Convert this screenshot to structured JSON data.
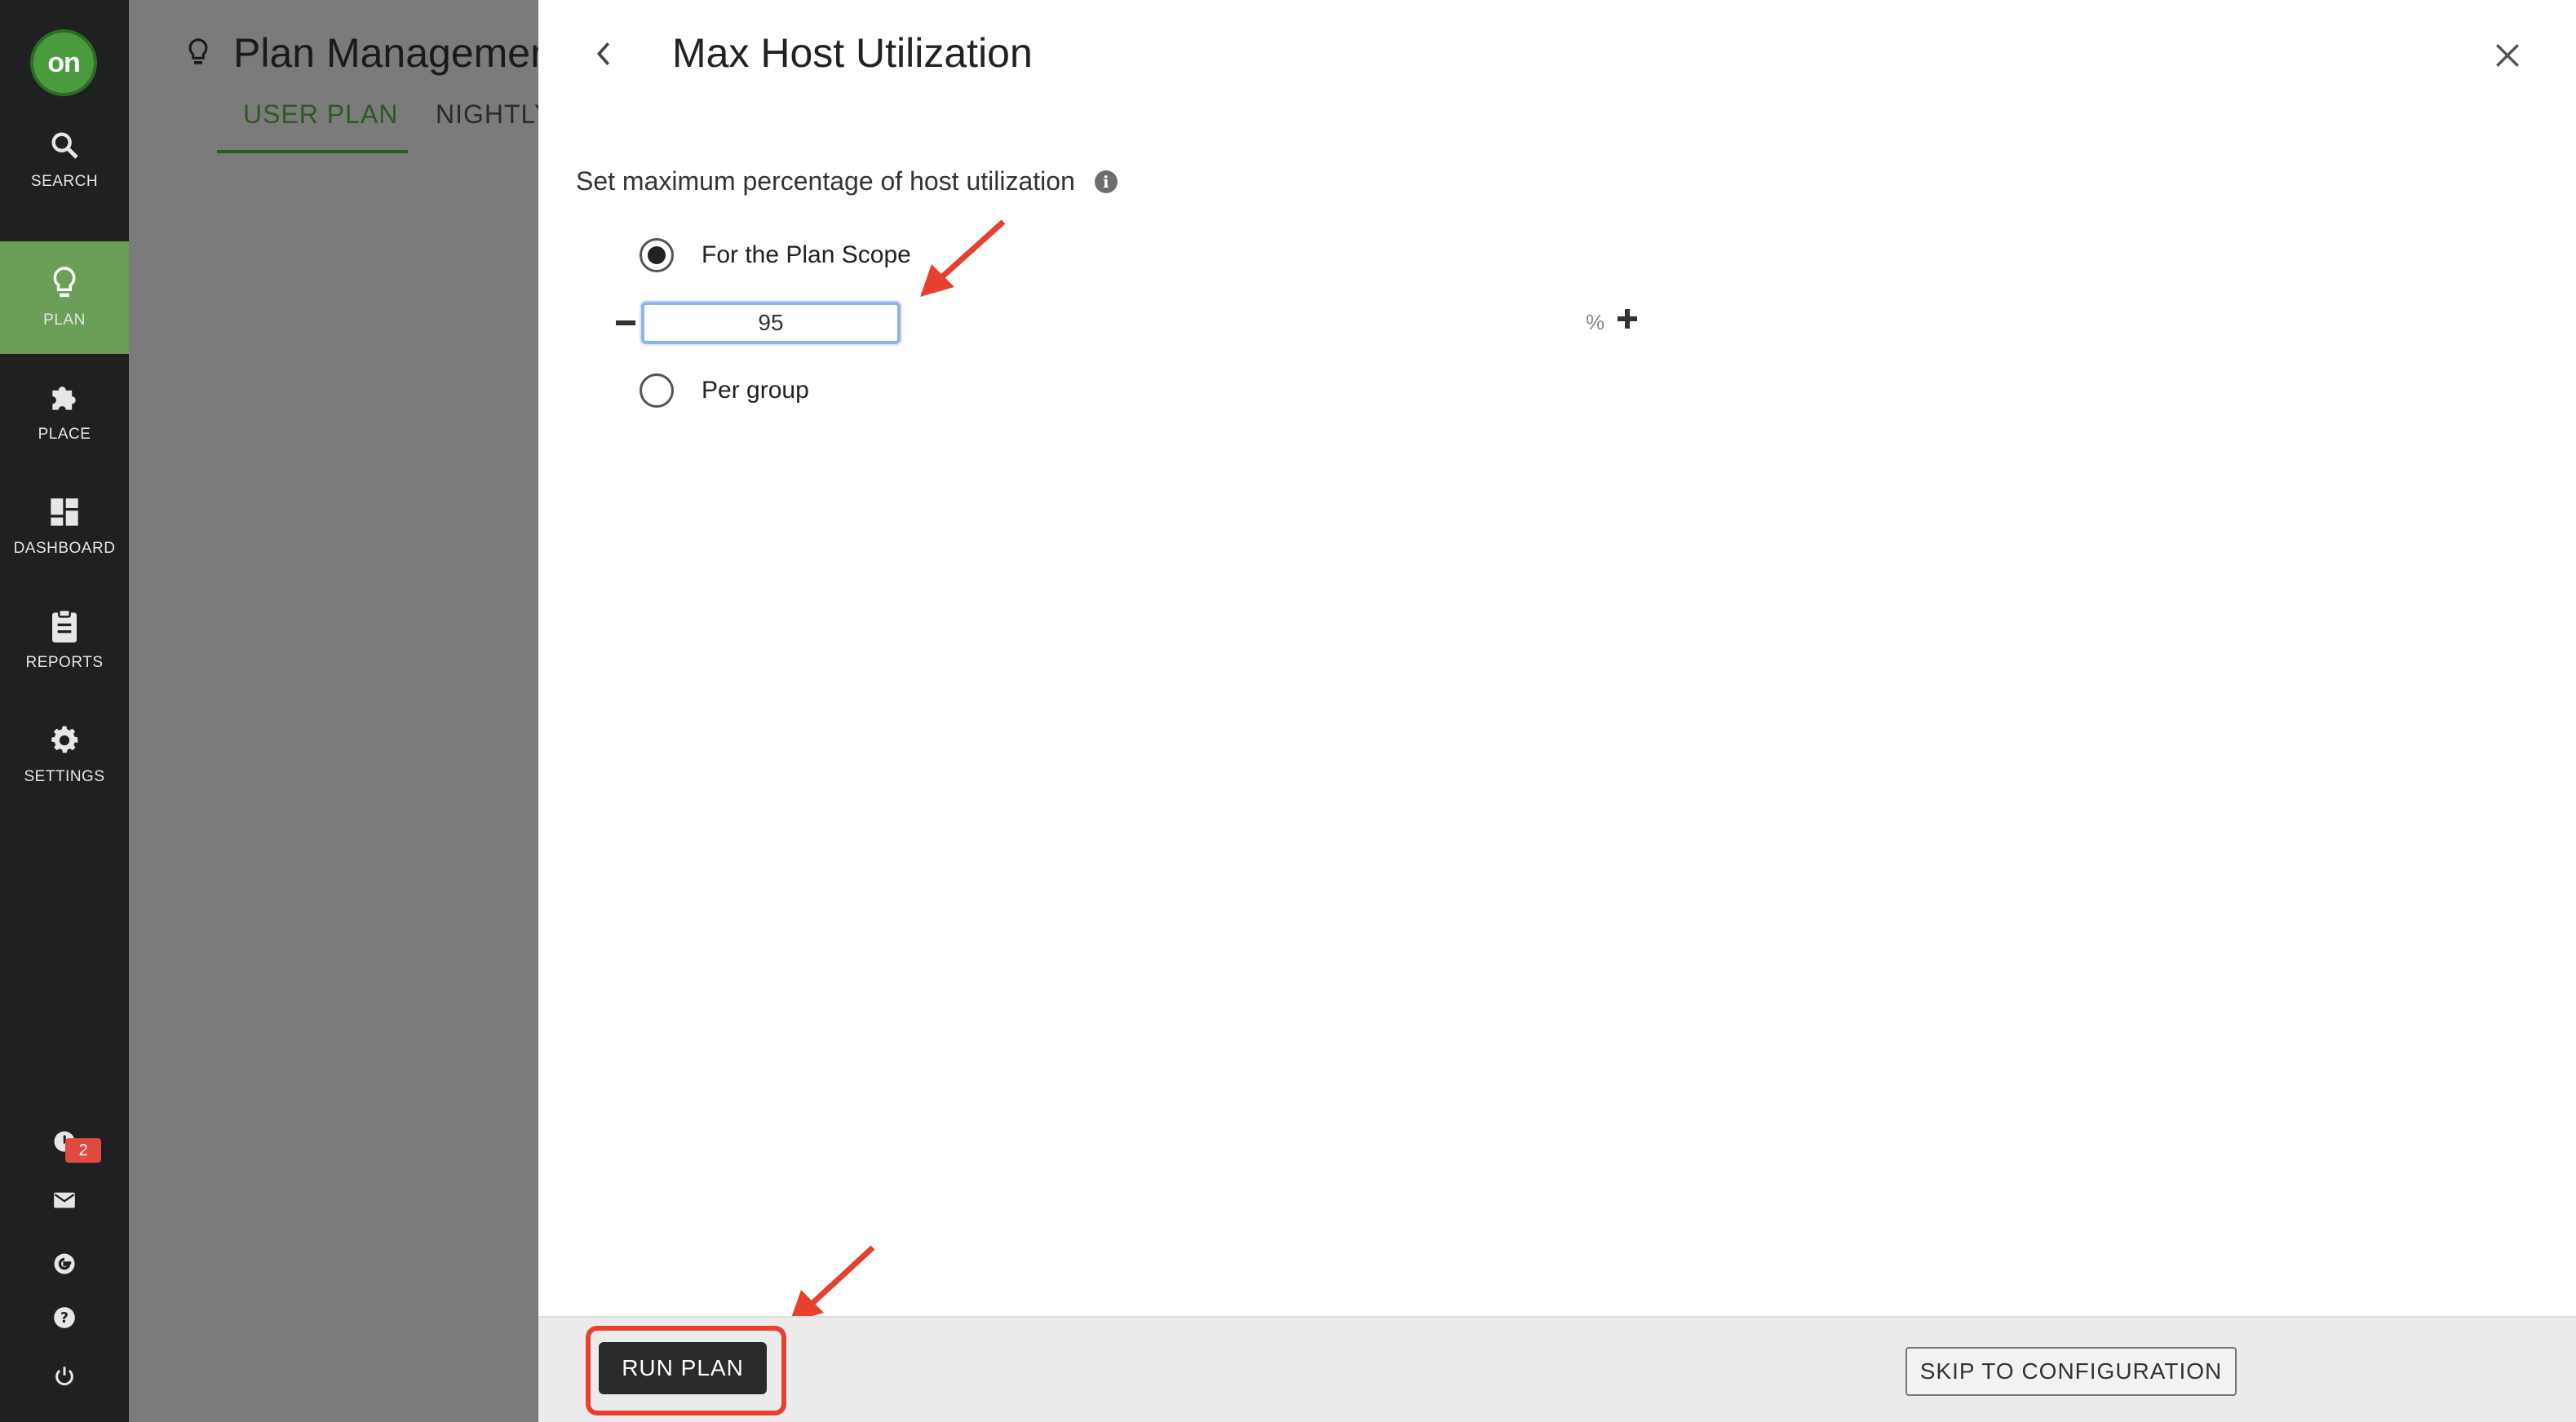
{
  "app": {
    "logo_text": "on",
    "brand_color": "#4a9a3e",
    "accent_active": "#6b9e57"
  },
  "sidebar": {
    "items": [
      {
        "label": "SEARCH",
        "icon": "search-icon"
      },
      {
        "label": "PLAN",
        "icon": "lightbulb-icon",
        "active": true
      },
      {
        "label": "PLACE",
        "icon": "puzzle-icon"
      },
      {
        "label": "DASHBOARD",
        "icon": "dashboard-icon"
      },
      {
        "label": "REPORTS",
        "icon": "clipboard-icon"
      },
      {
        "label": "SETTINGS",
        "icon": "gear-icon"
      }
    ],
    "bottom": {
      "notification_count": "2",
      "icons": [
        "notification-icon",
        "mail-icon",
        "google-icon",
        "help-icon",
        "power-icon"
      ]
    }
  },
  "background_page": {
    "title": "Plan Managemen",
    "tabs": [
      {
        "label": "USER PLAN",
        "active": true
      },
      {
        "label": "NIGHTLY"
      }
    ]
  },
  "panel": {
    "title": "Max Host Utilization",
    "section_label": "Set maximum percentage of host utilization",
    "options": [
      {
        "label": "For the Plan Scope",
        "checked": true
      },
      {
        "label": "Per group",
        "checked": false
      }
    ],
    "utilization": {
      "value": "95",
      "unit": "%"
    }
  },
  "footer": {
    "run_label": "RUN PLAN",
    "skip_label": "SKIP TO CONFIGURATION"
  },
  "annotations": {
    "arrow_color": "#e8402f"
  }
}
